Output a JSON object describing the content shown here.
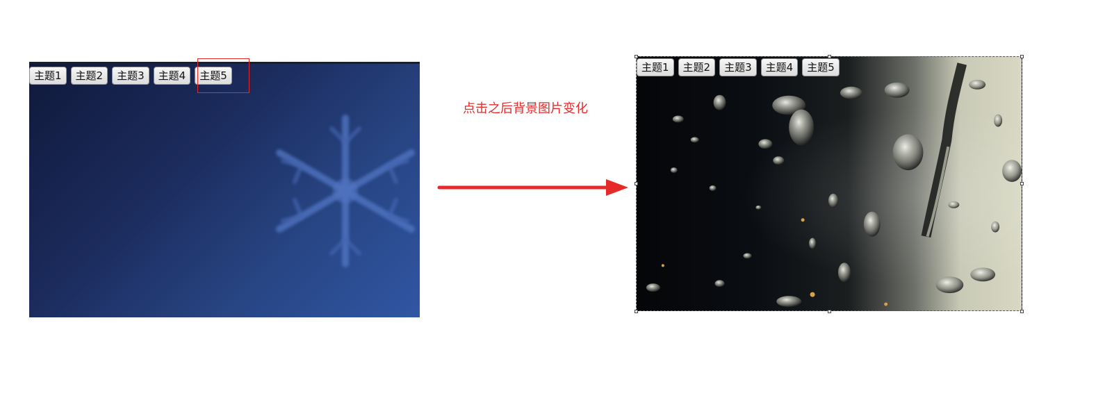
{
  "left_demo": {
    "theme_buttons": [
      "主题1",
      "主题2",
      "主题3",
      "主题4",
      "主题5"
    ],
    "selected_theme_index": 4,
    "accent_color": "#e62828"
  },
  "annotation": {
    "caption": "点击之后背景图片变化",
    "color": "#e62a2a"
  },
  "right_demo": {
    "theme_buttons": [
      "主题1",
      "主题2",
      "主题3",
      "主题4",
      "主题5"
    ]
  },
  "icons": {
    "snowflake": "snowflake-icon",
    "arrow": "right-arrow-icon"
  }
}
